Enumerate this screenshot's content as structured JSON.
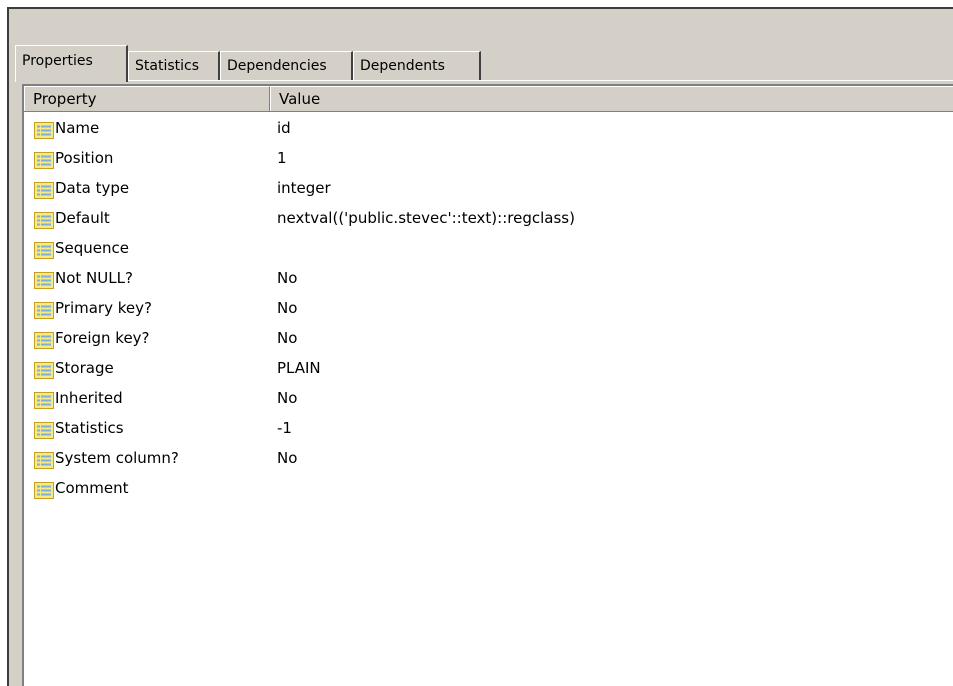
{
  "tabs": [
    {
      "label": "Properties",
      "active": true
    },
    {
      "label": "Statistics",
      "active": false
    },
    {
      "label": "Dependencies",
      "active": false
    },
    {
      "label": "Dependents",
      "active": false
    }
  ],
  "table": {
    "columns": [
      "Property",
      "Value"
    ],
    "rows": [
      {
        "property": "Name",
        "value": "id"
      },
      {
        "property": "Position",
        "value": "1"
      },
      {
        "property": "Data type",
        "value": "integer"
      },
      {
        "property": "Default",
        "value": "nextval(('public.stevec'::text)::regclass)"
      },
      {
        "property": "Sequence",
        "value": ""
      },
      {
        "property": "Not NULL?",
        "value": "No"
      },
      {
        "property": "Primary key?",
        "value": "No"
      },
      {
        "property": "Foreign key?",
        "value": "No"
      },
      {
        "property": "Storage",
        "value": "PLAIN"
      },
      {
        "property": "Inherited",
        "value": "No"
      },
      {
        "property": "Statistics",
        "value": "-1"
      },
      {
        "property": "System column?",
        "value": "No"
      },
      {
        "property": "Comment",
        "value": ""
      }
    ]
  },
  "icons": {
    "row_icon": "property-list-icon"
  },
  "colors": {
    "icon_fill": "#f5e98a",
    "icon_border": "#c8a020",
    "icon_lines": "#7fb0d8"
  }
}
